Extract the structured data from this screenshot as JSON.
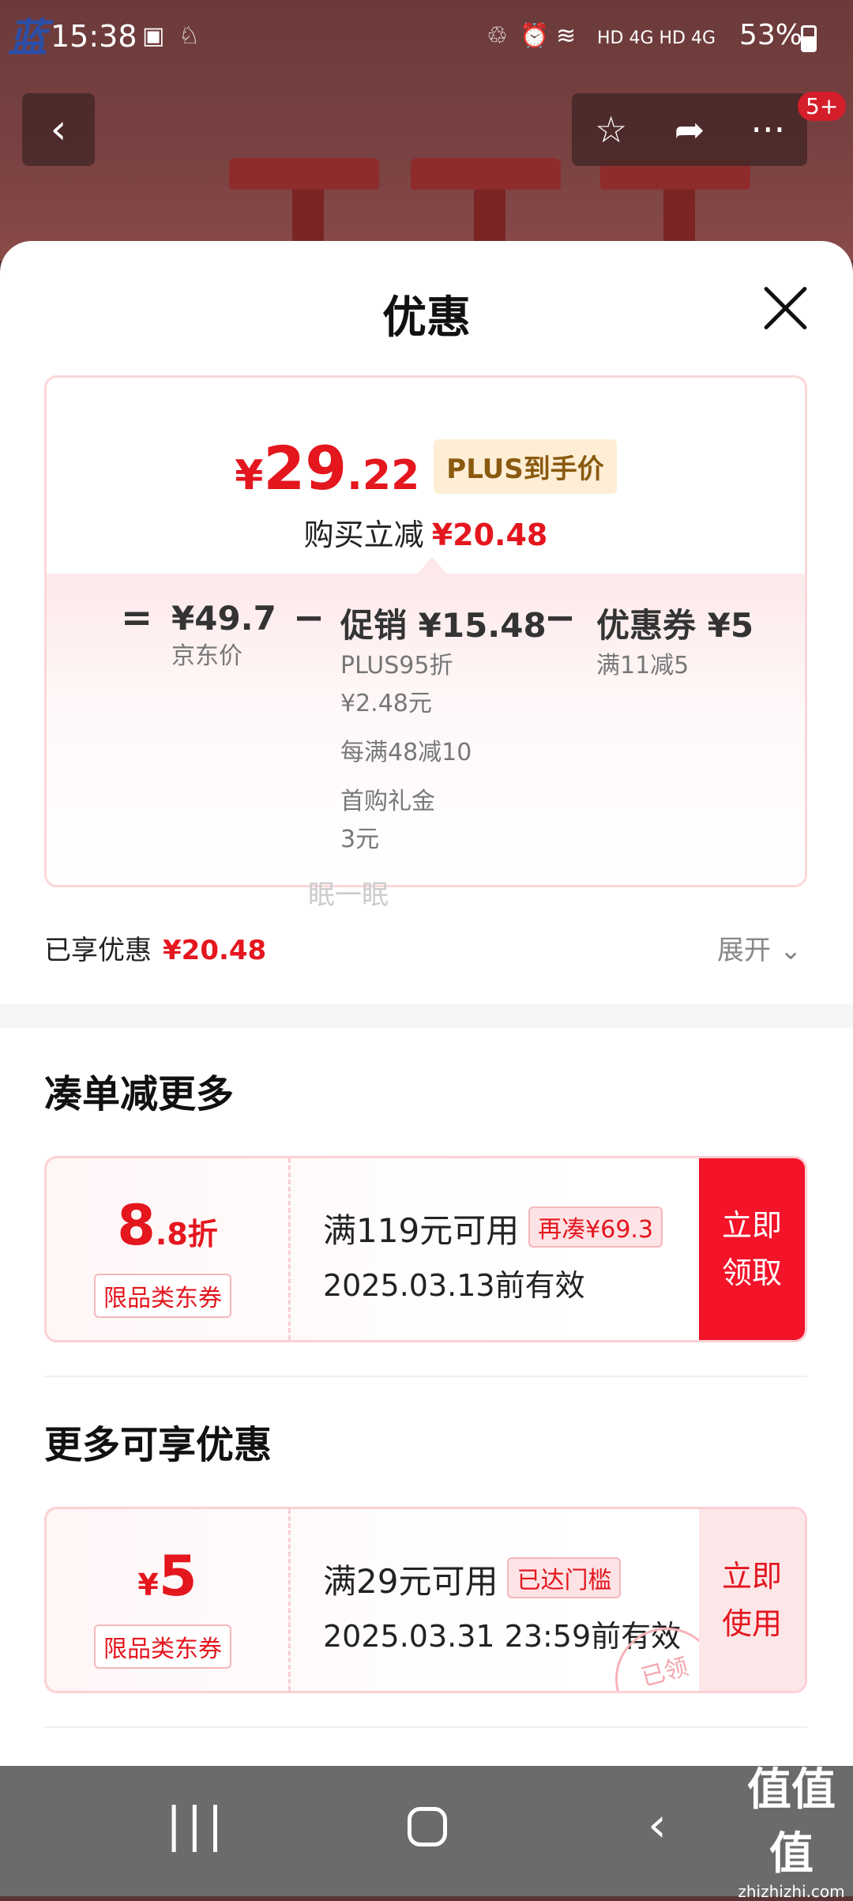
{
  "status_bar": {
    "logo_text": "蓝",
    "time": "15:38",
    "network": "HD 4G HD 4G",
    "battery": "53%"
  },
  "top_nav": {
    "more_count": "5+"
  },
  "sheet": {
    "title": "优惠",
    "price": {
      "currency": "¥",
      "integer": "29",
      "decimal": ".22",
      "tag": "PLUS到手价",
      "reduce_label": "购买立减",
      "reduce_value": "¥20.48"
    },
    "calc": {
      "eq": "=",
      "minus": "−",
      "jd_price": "¥49.7",
      "jd_price_label": "京东价",
      "promo_title": "促销 ¥15.48",
      "promo_items": [
        "PLUS95折",
        "¥2.48元",
        "每满48减10",
        "首购礼金",
        "3元"
      ],
      "coupon_title": "优惠券 ¥5",
      "coupon_item": "满11减5"
    },
    "overlay_text": "眠一眠",
    "enjoyed_label": "已享优惠",
    "enjoyed_value": "¥20.48",
    "expand_label": "展开",
    "section1_title": "凑单减更多",
    "coupon1": {
      "value_main": "8",
      "value_sub": ".8折",
      "tag": "限品类东券",
      "condition": "满119元可用",
      "hint": "再凑¥69.3",
      "validity": "2025.03.13前有效",
      "action": "立即领取"
    },
    "section2_title": "更多可享优惠",
    "coupon2": {
      "currency": "¥",
      "value_main": "5",
      "tag": "限品类东券",
      "condition": "满29元可用",
      "hint": "已达门槛",
      "validity": "2025.03.31 23:59前有效",
      "action": "立即使用",
      "stamp": "已领"
    }
  },
  "watermark": {
    "big": "值值值",
    "small": "zhizhizhi.com"
  },
  "colors": {
    "accent_red": "#e4161e",
    "action_red": "#f3142a"
  }
}
